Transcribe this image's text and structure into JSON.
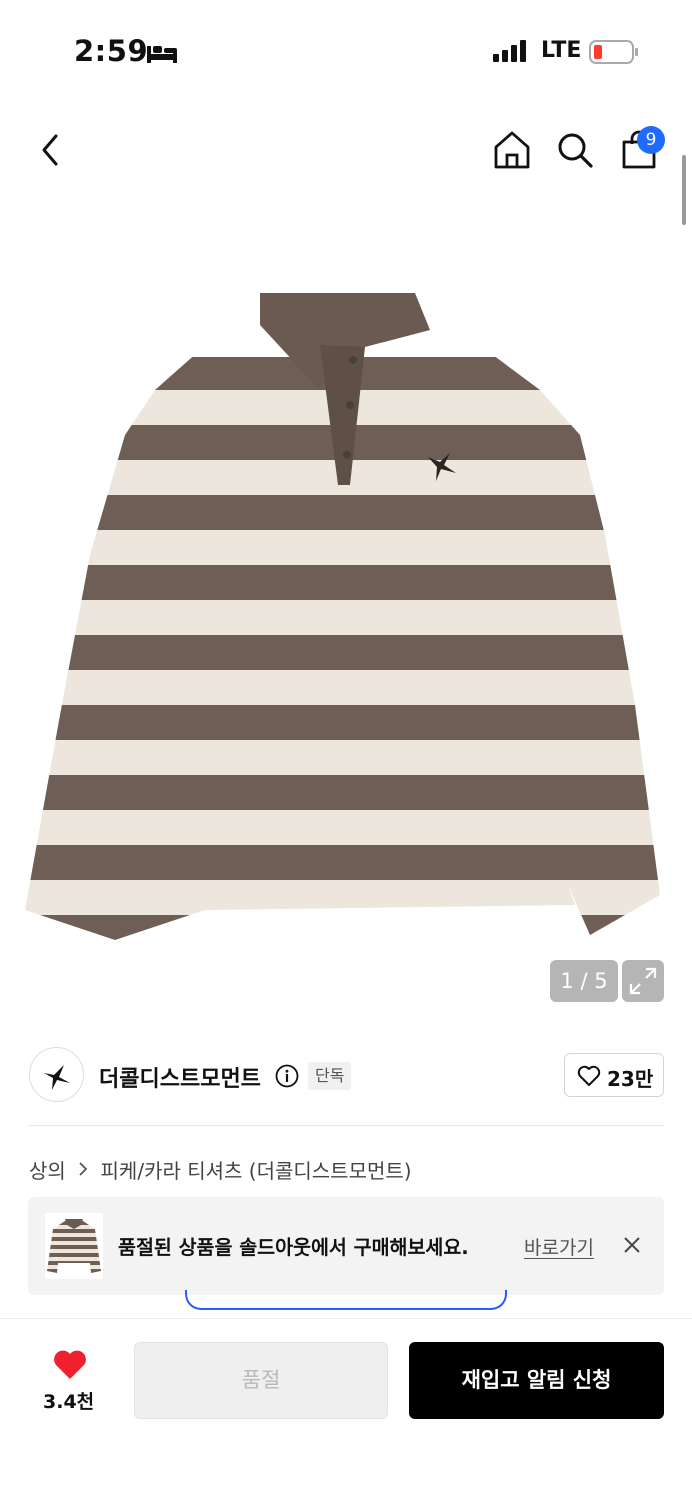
{
  "status_bar": {
    "time": "2:59",
    "network": "LTE",
    "icons": [
      "bed-icon",
      "signal-icon",
      "battery-low-icon"
    ]
  },
  "nav": {
    "cart_count": "9",
    "icons": [
      "back-chevron-icon",
      "home-icon",
      "search-icon",
      "shopping-bag-icon"
    ]
  },
  "gallery": {
    "counter": "1 / 5",
    "current": 1,
    "total": 5,
    "expand_icon": "expand-icon"
  },
  "brand": {
    "name": "더콜디스트모먼트",
    "badge": "단독",
    "likes": "23만"
  },
  "breadcrumb": {
    "category": "상의",
    "sub": "피케/카라 티셔츠 (더콜디스트모먼트)"
  },
  "soldout_banner": {
    "message": "품절된 상품을 솔드아웃에서 구매해보세요.",
    "link": "바로가기"
  },
  "bottom_bar": {
    "favorite_count": "3.4천",
    "soldout_label": "품절",
    "restock_label": "재입고 알림 신청"
  },
  "colors": {
    "accent_blue": "#1f6bff",
    "heart_red": "#ef1f2d",
    "stripe_brown": "#6e5e55",
    "stripe_cream": "#ece6dc"
  }
}
